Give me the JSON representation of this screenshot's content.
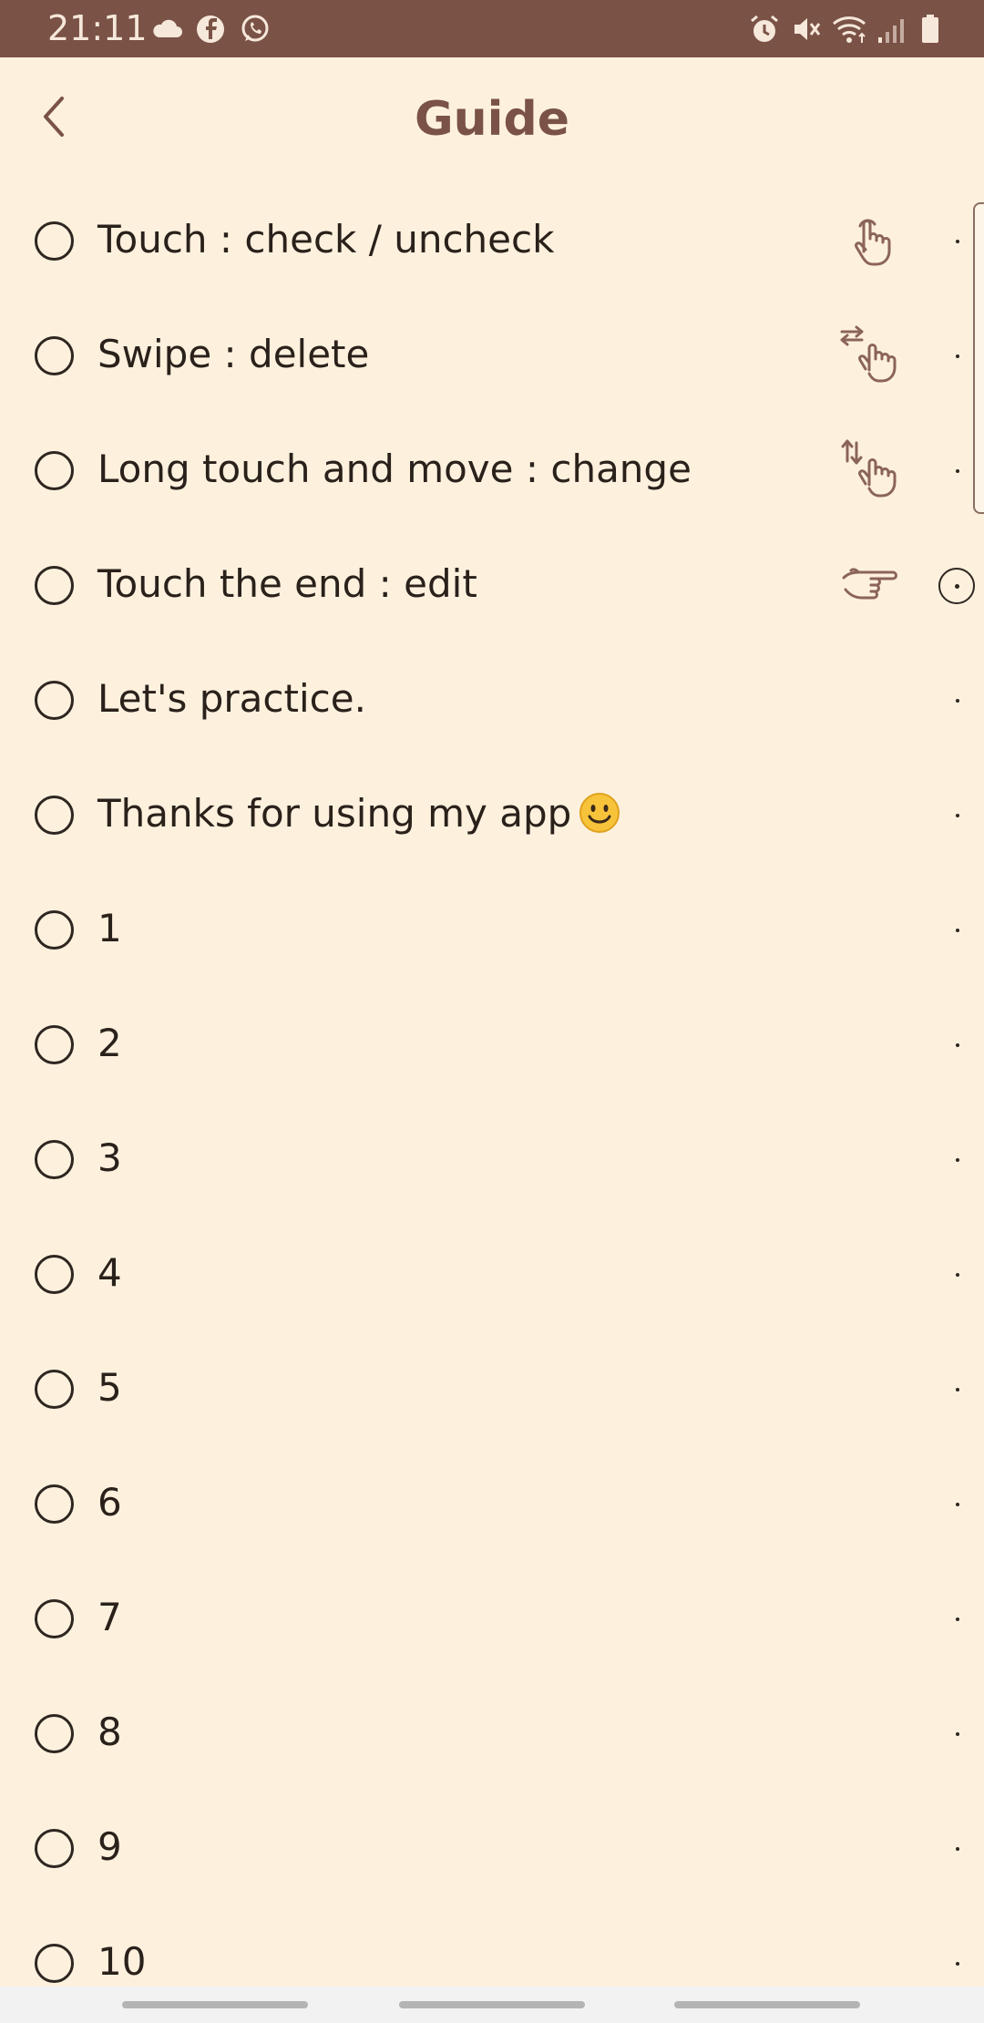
{
  "status_bar": {
    "time": "21:11",
    "left_icons": [
      "cloud-icon",
      "facebook-icon",
      "whatsapp-icon"
    ],
    "right_icons": [
      "alarm-icon",
      "mute-icon",
      "wifi-icon",
      "signal-icon",
      "battery-icon"
    ],
    "background": "#7A5246"
  },
  "header": {
    "title": "Guide",
    "back_icon": "chevron-left-icon"
  },
  "items": [
    {
      "label": "Touch : check / uncheck",
      "gesture_icon": "tap-hand-icon"
    },
    {
      "label": "Swipe : delete",
      "gesture_icon": "swipe-hand-icon"
    },
    {
      "label": "Long touch and move : change",
      "gesture_icon": "drag-hand-icon"
    },
    {
      "label": "Touch the end : edit",
      "gesture_icon": "pointing-hand-icon"
    },
    {
      "label": "Let's practice."
    },
    {
      "label": "Thanks for using my app",
      "emoji": "smiling-face-emoji"
    },
    {
      "label": "1"
    },
    {
      "label": "2"
    },
    {
      "label": "3"
    },
    {
      "label": "4"
    },
    {
      "label": "5"
    },
    {
      "label": "6"
    },
    {
      "label": "7"
    },
    {
      "label": "8"
    },
    {
      "label": "9"
    },
    {
      "label": "10"
    }
  ],
  "colors": {
    "background": "#FDF1DE",
    "accent": "#7A5246",
    "text": "#2A211B",
    "icon": "#8B6458"
  }
}
